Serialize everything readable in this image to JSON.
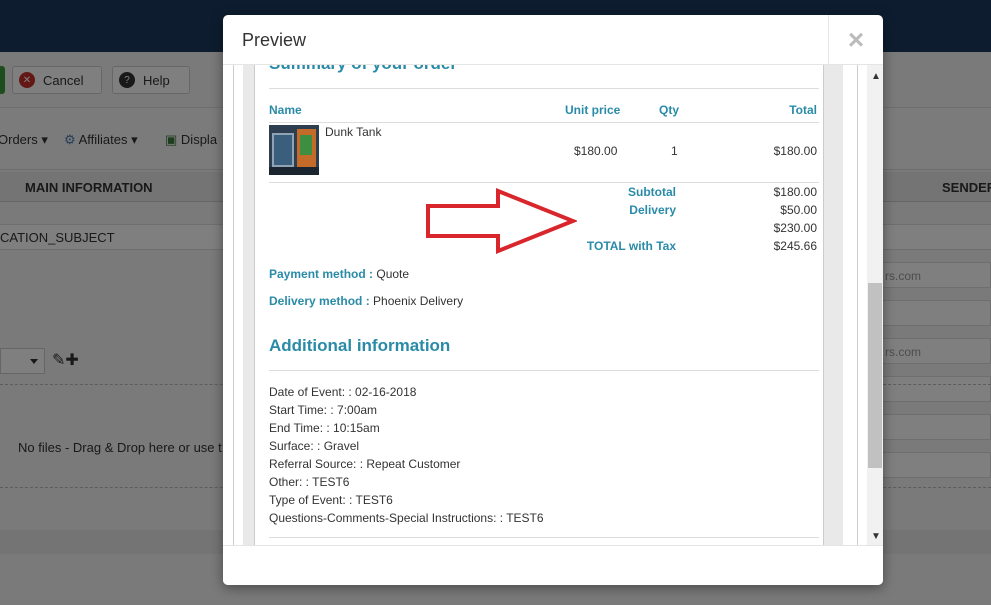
{
  "background": {
    "toolbar": {
      "cancel_label": "Cancel",
      "help_label": "Help"
    },
    "menu": [
      {
        "label": "Orders"
      },
      {
        "label": "Affiliates"
      },
      {
        "label": "Displa"
      }
    ],
    "section_header": "MAIN INFORMATION",
    "right_header": "SENDER",
    "subject_row": "CATION_SUBJECT",
    "dropzone_text": "No files - Drag & Drop here or use t",
    "right_field_1": "rs.com",
    "right_field_2": "rs.com"
  },
  "modal": {
    "title": "Preview",
    "close_symbol": "×",
    "summary_title": "Summary of your order",
    "table": {
      "headers": {
        "name": "Name",
        "unit_price": "Unit price",
        "qty": "Qty",
        "total": "Total"
      },
      "items": [
        {
          "name": "Dunk Tank",
          "unit_price": "$180.00",
          "qty": "1",
          "total": "$180.00"
        }
      ],
      "totals": [
        {
          "label": "Subtotal",
          "value": "$180.00"
        },
        {
          "label": "Delivery",
          "value": "$50.00"
        },
        {
          "label": "",
          "value": "$230.00"
        },
        {
          "label": "TOTAL with Tax",
          "value": "$245.66"
        }
      ]
    },
    "payment": {
      "label": "Payment method :",
      "value": "Quote"
    },
    "delivery": {
      "label": "Delivery method :",
      "value": "Phoenix Delivery"
    },
    "additional_title": "Additional information",
    "additional_lines": [
      "Date of Event: : 02-16-2018",
      "Start Time: : 7:00am",
      "End Time: : 10:15am",
      "Surface: : Gravel",
      "Referral Source: : Repeat Customer",
      "Other: : TEST6",
      "Type of Event: : TEST6",
      "Questions-Comments-Special Instructions: : TEST6"
    ]
  },
  "colors": {
    "accent": "#2a8ba8",
    "annotation_arrow": "#d9262c",
    "topbar": "#1b3a5e"
  }
}
